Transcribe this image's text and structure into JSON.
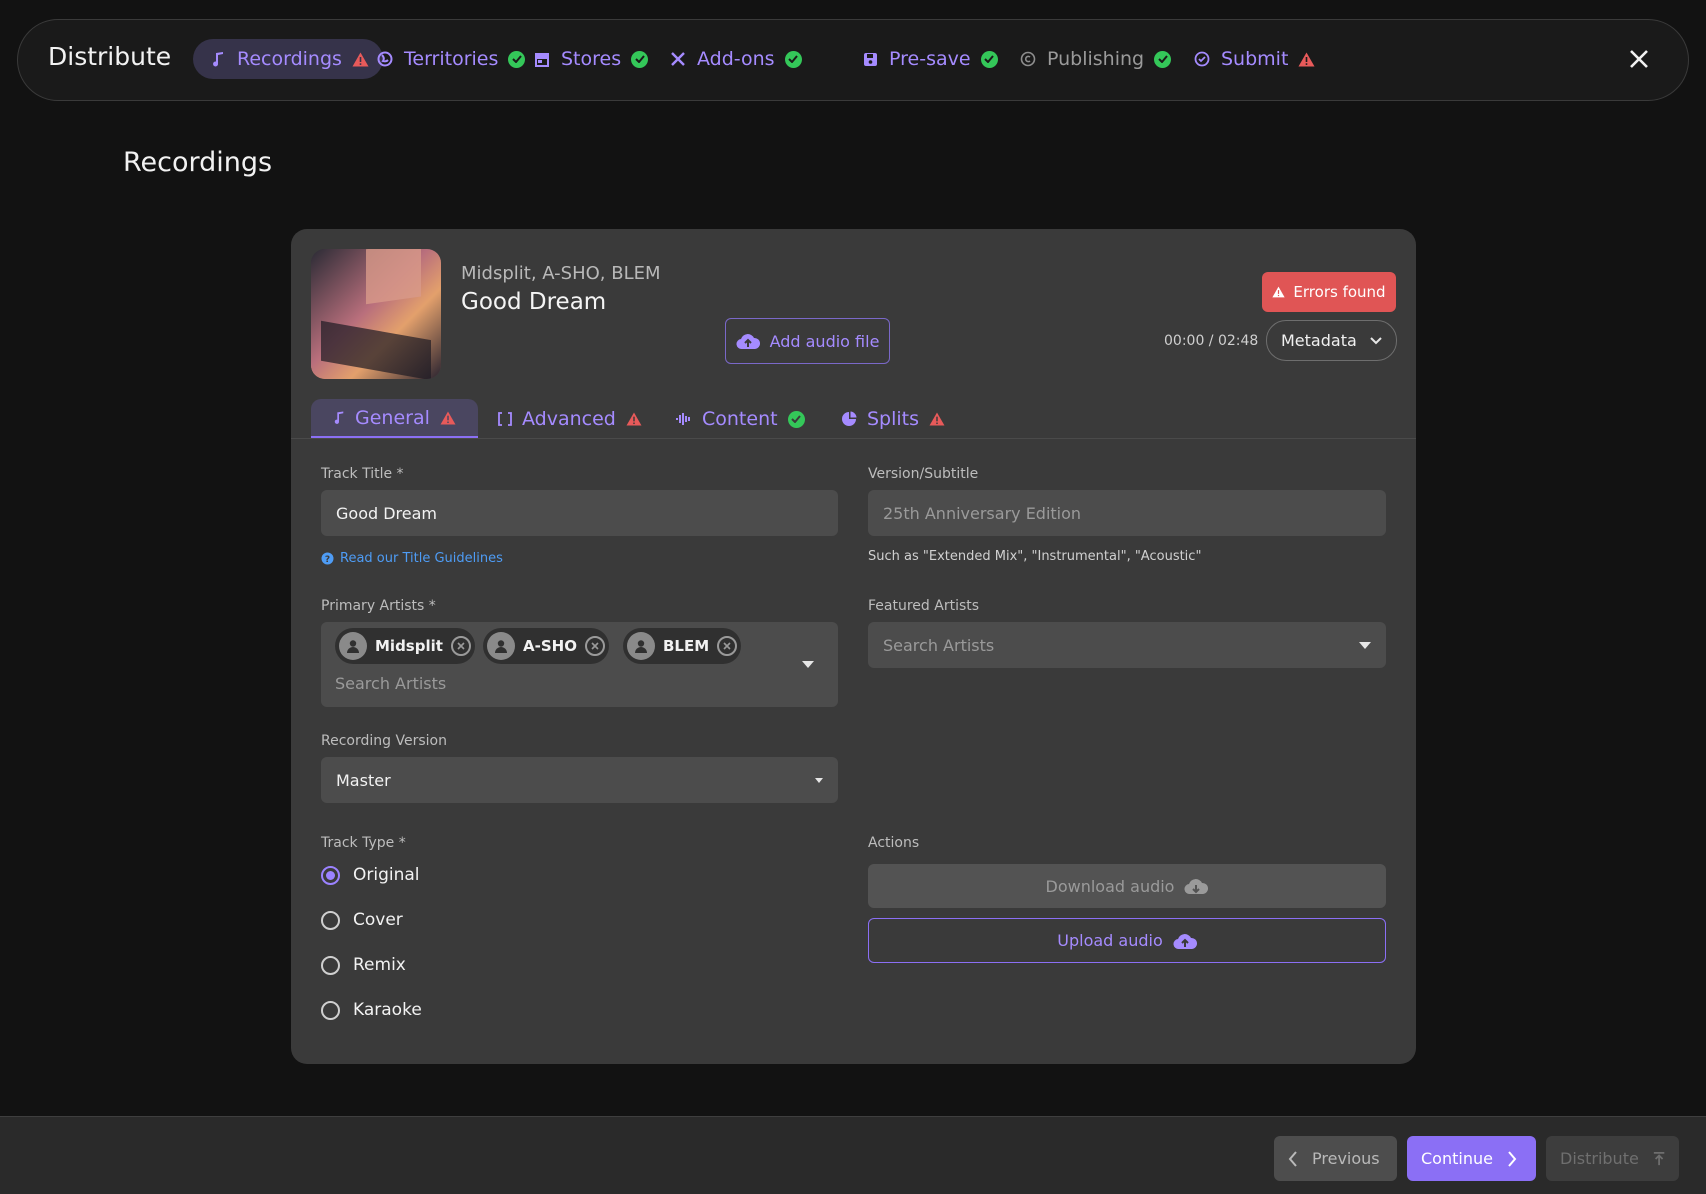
{
  "app": {
    "title": "Distribute",
    "close_label": "Close"
  },
  "nav": {
    "steps": [
      {
        "label": "Recordings",
        "status": "error",
        "icon": "music-note-icon"
      },
      {
        "label": "Territories",
        "status": "ok",
        "icon": "globe-icon"
      },
      {
        "label": "Stores",
        "status": "ok",
        "icon": "store-icon"
      },
      {
        "label": "Add-ons",
        "status": "ok",
        "icon": "tools-icon"
      },
      {
        "label": "Pre-save",
        "status": "ok",
        "icon": "save-icon"
      },
      {
        "label": "Publishing",
        "status": "ok",
        "icon": "copyright-icon"
      },
      {
        "label": "Submit",
        "status": "error",
        "icon": "check-circle-icon"
      }
    ]
  },
  "page": {
    "title": "Recordings"
  },
  "track": {
    "artists": "Midsplit, A-SHO, BLEM",
    "title": "Good Dream",
    "add_audio_label": "Add audio file",
    "errors_label": "Errors found",
    "time": "00:00 / 02:48",
    "metadata_label": "Metadata"
  },
  "tabs": [
    {
      "label": "General",
      "status": "error"
    },
    {
      "label": "Advanced",
      "status": "error"
    },
    {
      "label": "Content",
      "status": "ok"
    },
    {
      "label": "Splits",
      "status": "error"
    }
  ],
  "form": {
    "track_title_label": "Track Title *",
    "track_title_value": "Good Dream",
    "title_guidelines_link": "Read our Title Guidelines",
    "version_label": "Version/Subtitle",
    "version_placeholder": "25th Anniversary Edition",
    "version_hint": "Such as \"Extended Mix\", \"Instrumental\", \"Acoustic\"",
    "primary_artists_label": "Primary Artists *",
    "primary_artists": [
      "Midsplit",
      "A-SHO",
      "BLEM"
    ],
    "primary_search_placeholder": "Search Artists",
    "featured_artists_label": "Featured Artists",
    "featured_search_placeholder": "Search Artists",
    "recording_version_label": "Recording Version",
    "recording_version_value": "Master",
    "track_type_label": "Track Type *",
    "track_types": [
      "Original",
      "Cover",
      "Remix",
      "Karaoke"
    ],
    "track_type_selected": "Original",
    "actions_label": "Actions",
    "download_label": "Download audio",
    "upload_label": "Upload audio"
  },
  "footer": {
    "previous_label": "Previous",
    "continue_label": "Continue",
    "distribute_label": "Distribute"
  },
  "colors": {
    "accent": "#8b6ff5",
    "accent_text": "#a58bff",
    "ok": "#34c759",
    "error": "#e05555",
    "background": "#121212",
    "card": "#3a3a3a"
  }
}
